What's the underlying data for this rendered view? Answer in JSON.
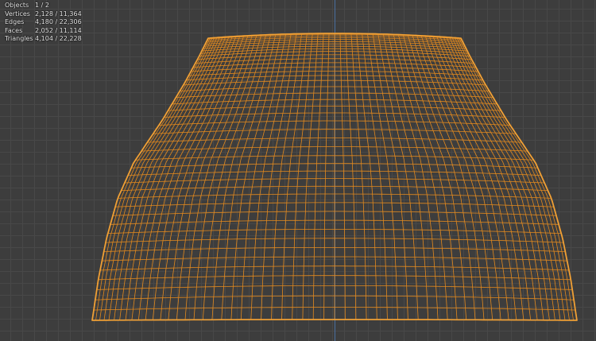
{
  "viewport": {
    "background_color": "#3d3d3d",
    "grid_color": "#484848",
    "axis_color": "#4a6fa0",
    "mesh_color": "#e2891e",
    "mesh_outline_color": "#f0a33a"
  },
  "stats": {
    "rows": [
      {
        "label": "Objects",
        "value": "1 / 2"
      },
      {
        "label": "Vertices",
        "value": "2,128 / 11,364"
      },
      {
        "label": "Edges",
        "value": "4,180 / 22,306"
      },
      {
        "label": "Faces",
        "value": "2,052 / 11,114"
      },
      {
        "label": "Triangles",
        "value": "4,104 / 22,228"
      }
    ]
  }
}
